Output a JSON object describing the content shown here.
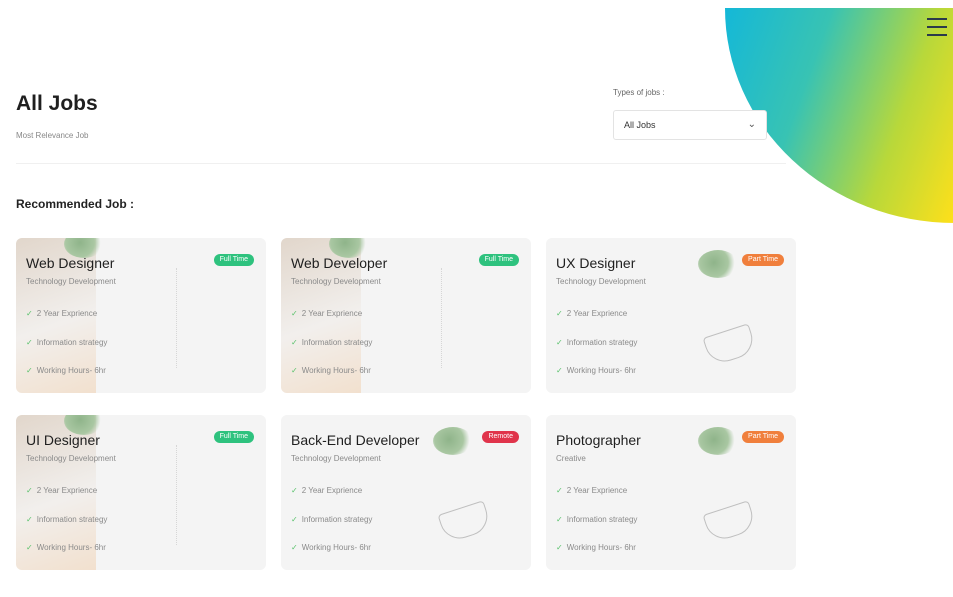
{
  "header": {
    "title": "All Jobs",
    "subtitle": "Most Relevance Job",
    "types_label": "Types of jobs :",
    "types_selected": "All Jobs"
  },
  "section_title": "Recommended Job :",
  "colors": {
    "full_time": "#2ec27e",
    "part_time": "#f07f3c",
    "remote": "#e0344b",
    "check": "#59c26b"
  },
  "jobs": [
    {
      "title": "Web Designer",
      "category": "Technology Development",
      "badge": "Full Time",
      "features": [
        "2 Year Exprience",
        "Information strategy",
        "Working Hours- 6hr"
      ]
    },
    {
      "title": "Web Developer",
      "category": "Technology Development",
      "badge": "Full Time",
      "features": [
        "2 Year Exprience",
        "Information strategy",
        "Working Hours- 6hr"
      ]
    },
    {
      "title": "UX Designer",
      "category": "Technology Development",
      "badge": "Part Time",
      "features": [
        "2 Year Exprience",
        "Information strategy",
        "Working Hours- 6hr"
      ]
    },
    {
      "title": "UI Designer",
      "category": "Technology Development",
      "badge": "Full Time",
      "features": [
        "2 Year Exprience",
        "Information strategy",
        "Working Hours- 6hr"
      ]
    },
    {
      "title": "Back-End Developer",
      "category": "Technology Development",
      "badge": "Remote",
      "features": [
        "2 Year Exprience",
        "Information strategy",
        "Working Hours- 6hr"
      ]
    },
    {
      "title": "Photographer",
      "category": "Creative",
      "badge": "Part Time",
      "features": [
        "2 Year Exprience",
        "Information strategy",
        "Working Hours- 6hr"
      ]
    }
  ],
  "icons": {
    "menu": "hamburger-menu-icon",
    "check": "check-icon",
    "chevron": "chevron-down-icon"
  }
}
